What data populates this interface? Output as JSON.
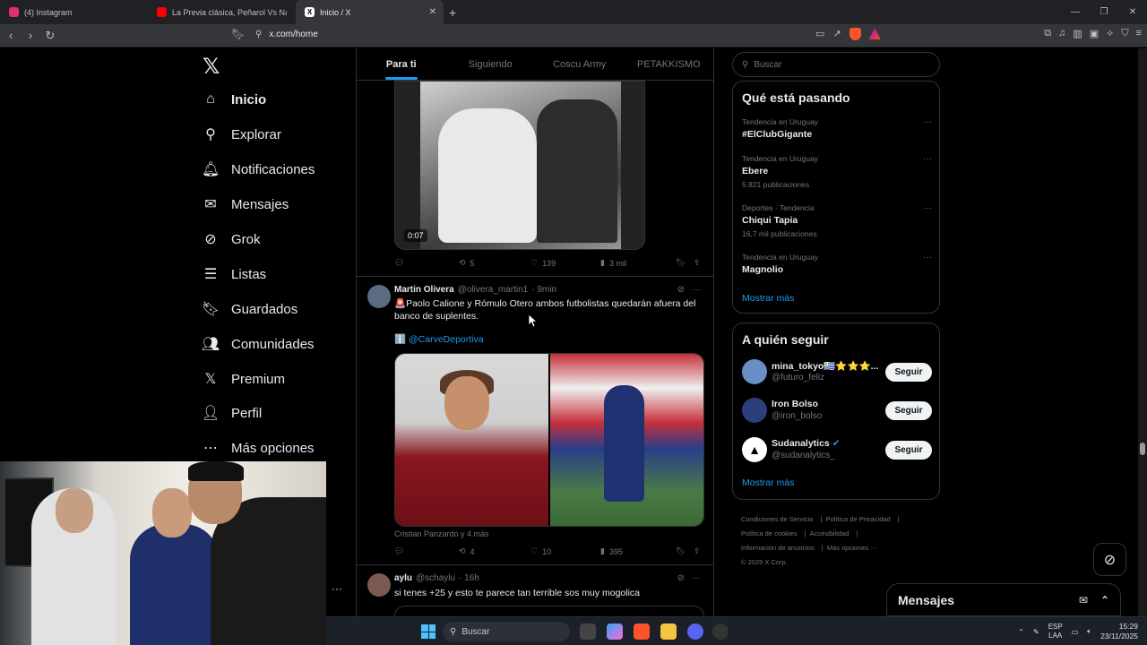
{
  "browser": {
    "tabs": [
      {
        "label": "(4) Instagram",
        "color": "#e1306c"
      },
      {
        "label": "La Previa clásica, Peñarol Vs Naci",
        "color": "#ff0000"
      },
      {
        "label": "Inicio / X",
        "color": "#000000"
      }
    ],
    "url": "x.com/home"
  },
  "nav": {
    "items": [
      {
        "label": "Inicio",
        "icon": "home-icon"
      },
      {
        "label": "Explorar",
        "icon": "search-icon"
      },
      {
        "label": "Notificaciones",
        "icon": "bell-icon"
      },
      {
        "label": "Mensajes",
        "icon": "envelope-icon"
      },
      {
        "label": "Grok",
        "icon": "grok-icon"
      },
      {
        "label": "Listas",
        "icon": "list-icon"
      },
      {
        "label": "Guardados",
        "icon": "bookmark-icon"
      },
      {
        "label": "Comunidades",
        "icon": "people-icon"
      },
      {
        "label": "Premium",
        "icon": "x-icon"
      },
      {
        "label": "Perfil",
        "icon": "person-icon"
      },
      {
        "label": "Más opciones",
        "icon": "more-circle-icon"
      }
    ]
  },
  "timeline": {
    "tabs": [
      "Para ti",
      "Siguiendo",
      "Coscu Army",
      "PETAKKISMO"
    ],
    "video_time": "0:07",
    "tweet0_actions": {
      "replies": "",
      "reposts": "5",
      "likes": "139",
      "views": "3 mil"
    },
    "tweet1": {
      "name": "Martin Olivera",
      "handle": "@olivera_martin1",
      "time": "· 9min",
      "text": "🚨Paolo Calione y Rómulo Otero ambos futbolistas quedarán afuera del banco de suplentes.",
      "source_prefix": "ℹ️",
      "source_link": "@CarveDeportiva",
      "caption": "Cristian Panzardo y 4 más",
      "actions": {
        "replies": "",
        "reposts": "4",
        "likes": "10",
        "views": "395"
      }
    },
    "tweet2": {
      "name": "aylu",
      "handle": "@schaylu",
      "time": "· 16h",
      "text": "si tenes +25 y esto te parece tan terrible sos muy mogolica"
    }
  },
  "right": {
    "search_placeholder": "Buscar",
    "trending_title": "Qué está pasando",
    "trends": [
      {
        "meta": "Tendencia en Uruguay",
        "topic": "#ElClubGigante",
        "count": ""
      },
      {
        "meta": "Tendencia en Uruguay",
        "topic": "Ebere",
        "count": "5.821 publicaciones"
      },
      {
        "meta": "Deportes · Tendencia",
        "topic": "Chiqui Tapia",
        "count": "16,7 mil publicaciones"
      },
      {
        "meta": "Tendencia en Uruguay",
        "topic": "Magnolio",
        "count": ""
      }
    ],
    "show_more": "Mostrar más",
    "follow_title": "A quién seguir",
    "follow": [
      {
        "name": "mina_tokyo🇺🇾⭐⭐⭐...",
        "handle": "@futuro_feliz",
        "button": "Seguir",
        "color": "#6a8fc7"
      },
      {
        "name": "Iron Bolso",
        "handle": "@iron_bolso",
        "button": "Seguir",
        "color": "#2b3f7a"
      },
      {
        "name": "Sudanalytics",
        "handle": "@sudanalytics_",
        "button": "Seguir",
        "color": "#ffffff"
      }
    ],
    "footer": [
      "Condiciones de Servicio",
      "Política de Privacidad",
      "Política de cookies",
      "Accesibilidad",
      "Información de anuncios",
      "Más opciones ···",
      "© 2025 X Corp."
    ]
  },
  "dock": {
    "title": "Mensajes"
  },
  "taskbar": {
    "search": "Buscar",
    "lang_line1": "ESP",
    "lang_line2": "LAA",
    "time": "15:29",
    "date": "23/11/2025"
  }
}
